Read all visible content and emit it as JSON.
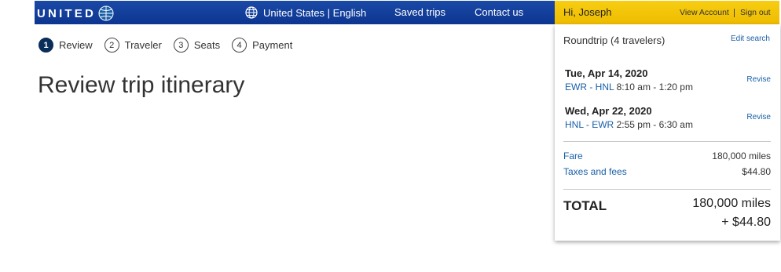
{
  "header": {
    "logo_text": "UNITED",
    "locale": "United States | English",
    "nav_saved": "Saved trips",
    "nav_contact": "Contact us"
  },
  "account": {
    "greeting": "Hi, Joseph",
    "view_account": "View Account",
    "sign_out": "Sign out"
  },
  "steps": [
    {
      "num": "1",
      "label": "Review"
    },
    {
      "num": "2",
      "label": "Traveler"
    },
    {
      "num": "3",
      "label": "Seats"
    },
    {
      "num": "4",
      "label": "Payment"
    }
  ],
  "page_title": "Review trip itinerary",
  "summary": {
    "heading": "Roundtrip (4 travelers)",
    "edit_search": "Edit search",
    "segments": [
      {
        "date": "Tue, Apr 14, 2020",
        "route": "EWR - HNL",
        "times": "8:10 am - 1:20 pm",
        "revise": "Revise"
      },
      {
        "date": "Wed, Apr 22, 2020",
        "route": "HNL - EWR",
        "times": "2:55 pm - 6:30 am",
        "revise": "Revise"
      }
    ],
    "fare_label": "Fare",
    "fare_value": "180,000 miles",
    "taxes_label": "Taxes and fees",
    "taxes_value": "$44.80",
    "total_label": "TOTAL",
    "total_miles": "180,000 miles",
    "total_cash": "+ $44.80"
  },
  "colors": {
    "nav_blue": "#0c3591",
    "account_yellow": "#f2c400",
    "link_blue": "#1a5fa8",
    "step_active": "#0a2d5a"
  }
}
